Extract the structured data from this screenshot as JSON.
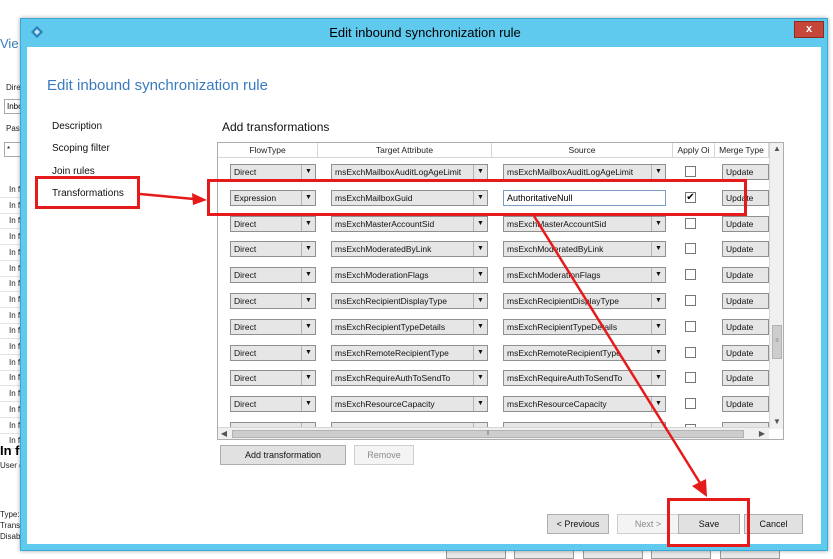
{
  "background": {
    "title": "Vie",
    "labels": [
      "Dire",
      "Inbo",
      "Pass",
      "*"
    ],
    "row_text": "In f",
    "bold_text": "In f",
    "sub_text": "User o",
    "bottom_labels": [
      "Type:",
      "Trans",
      "Disab"
    ]
  },
  "dialog": {
    "title": "Edit inbound synchronization rule",
    "close_label": "x",
    "heading": "Edit inbound synchronization rule",
    "nav": [
      "Description",
      "Scoping filter",
      "Join rules",
      "Transformations"
    ],
    "section_title": "Add transformations",
    "grid": {
      "columns": [
        "FlowType",
        "Target Attribute",
        "Source",
        "Apply Oi",
        "Merge Type"
      ],
      "rows": [
        {
          "flow": "Direct",
          "target": "msExchMailboxAuditLogAgeLimit",
          "source": "msExchMailboxAuditLogAgeLimit",
          "apply": false,
          "merge": "Update"
        },
        {
          "flow": "Expression",
          "target": "msExchMailboxGuid",
          "source": "AuthoritativeNull",
          "apply": true,
          "merge": "Update"
        },
        {
          "flow": "Direct",
          "target": "msExchMasterAccountSid",
          "source": "msExchMasterAccountSid",
          "apply": false,
          "merge": "Update"
        },
        {
          "flow": "Direct",
          "target": "msExchModeratedByLink",
          "source": "msExchModeratedByLink",
          "apply": false,
          "merge": "Update"
        },
        {
          "flow": "Direct",
          "target": "msExchModerationFlags",
          "source": "msExchModerationFlags",
          "apply": false,
          "merge": "Update"
        },
        {
          "flow": "Direct",
          "target": "msExchRecipientDisplayType",
          "source": "msExchRecipientDisplayType",
          "apply": false,
          "merge": "Update"
        },
        {
          "flow": "Direct",
          "target": "msExchRecipientTypeDetails",
          "source": "msExchRecipientTypeDetails",
          "apply": false,
          "merge": "Update"
        },
        {
          "flow": "Direct",
          "target": "msExchRemoteRecipientType",
          "source": "msExchRemoteRecipientType",
          "apply": false,
          "merge": "Update"
        },
        {
          "flow": "Direct",
          "target": "msExchRequireAuthToSendTo",
          "source": "msExchRequireAuthToSendTo",
          "apply": false,
          "merge": "Update"
        },
        {
          "flow": "Direct",
          "target": "msExchResourceCapacity",
          "source": "msExchResourceCapacity",
          "apply": false,
          "merge": "Update"
        },
        {
          "flow": "",
          "target": "",
          "source": "msExchResourceDisplay",
          "apply": false,
          "merge": ""
        }
      ]
    },
    "add_transformation_label": "Add transformation",
    "remove_label": "Remove",
    "previous_label": "< Previous",
    "next_label": "Next >",
    "save_label": "Save",
    "cancel_label": "Cancel"
  },
  "colors": {
    "dialog_frame": "#5fc9ee",
    "heading": "#3a7bbf",
    "annotation": "#e51b1b",
    "close_button": "#c6473a"
  }
}
